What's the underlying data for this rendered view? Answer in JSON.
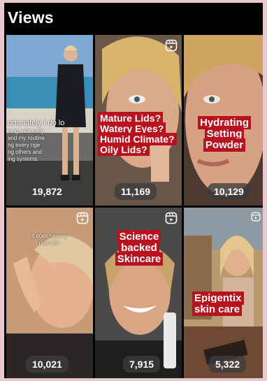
{
  "header": {
    "title": "Views"
  },
  "icons": {
    "reel": "reel-icon"
  },
  "colors": {
    "caption_bg": "#b8121e",
    "badge_bg": "#3c3c3c",
    "page_bg": "#e9c9cd"
  },
  "tiles": [
    {
      "views": "19,872",
      "overlay_lines": [
        "ortunately I do lo",
        "long a bit early",
        "and my routine",
        "ng every nge",
        "ng others and",
        "ing systems"
      ]
    },
    {
      "views": "11,169",
      "caption_lines": [
        "Mature Lids?",
        "Watery Eyes?",
        "Humid Climate?",
        "Oily Lids?"
      ]
    },
    {
      "views": "10,129",
      "caption_lines": [
        "Hydrating",
        "Setting",
        "Powder"
      ]
    },
    {
      "views": "10,021",
      "overlay_lines": [
        "it does have a",
        "rose tint"
      ]
    },
    {
      "views": "7,915",
      "caption_lines": [
        "Science backed",
        "Skincare"
      ]
    },
    {
      "views": "5,322",
      "caption_lines": [
        "Epigentix",
        "skin care"
      ]
    }
  ]
}
